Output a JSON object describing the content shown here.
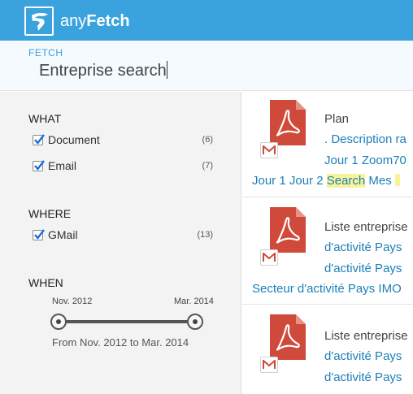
{
  "app": {
    "brand_prefix": "any",
    "brand_suffix": "Fetch",
    "accent_color": "#3aa3dd"
  },
  "search": {
    "label": "FETCH",
    "value": "Entreprise search"
  },
  "sidebar": {
    "what": {
      "title": "WHAT",
      "items": [
        {
          "label": "Document",
          "count": "(6)",
          "checked": true
        },
        {
          "label": "Email",
          "count": "(7)",
          "checked": true
        }
      ]
    },
    "where": {
      "title": "WHERE",
      "items": [
        {
          "label": "GMail",
          "count": "(13)",
          "checked": true
        }
      ]
    },
    "when": {
      "title": "WHEN",
      "start_label": "Nov. 2012",
      "end_label": "Mar. 2014",
      "summary": "From Nov. 2012 to Mar. 2014"
    }
  },
  "results": [
    {
      "title": "Plan",
      "line1": ". Description ra",
      "line2": "Jour 1 Zoom70",
      "line3_before": "Jour 1 Jour 2 ",
      "line3_highlight": "Search",
      "line3_after": " Mes ",
      "icon": "pdf-icon",
      "source_icon": "gmail-icon"
    },
    {
      "title": "Liste entreprise",
      "line1": "d'activité Pays",
      "line2": "d'activité Pays",
      "line3": "Secteur d'activité Pays IMO",
      "icon": "pdf-icon",
      "source_icon": "gmail-icon"
    },
    {
      "title": "Liste entreprise",
      "line1": "d'activité Pays",
      "line2": "d'activité Pays",
      "icon": "pdf-icon",
      "source_icon": "gmail-icon"
    }
  ]
}
